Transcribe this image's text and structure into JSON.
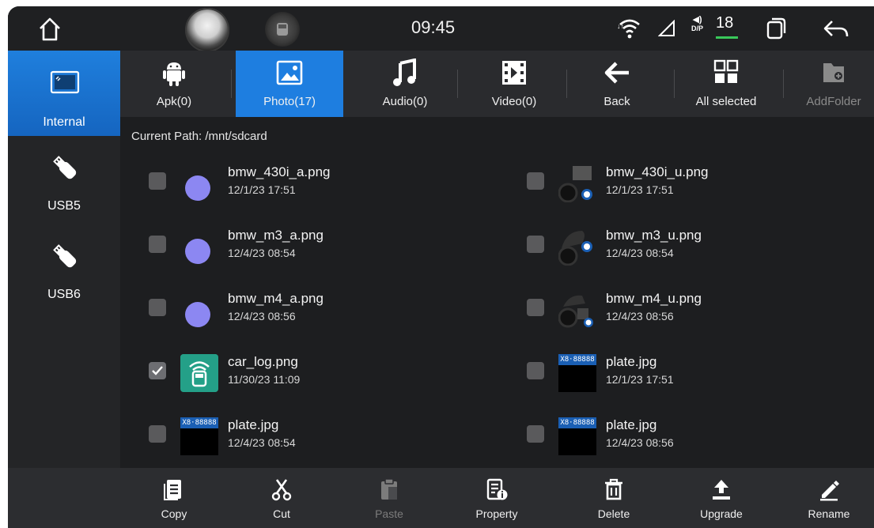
{
  "status_bar": {
    "time": "09:45",
    "volume_label": "D/P",
    "volume_value": "18",
    "accent_green": "#39c85a"
  },
  "sidebar": {
    "items": [
      {
        "label": "Internal",
        "icon": "storage-icon",
        "active": true
      },
      {
        "label": "USB5",
        "icon": "usb-icon",
        "active": false
      },
      {
        "label": "USB6",
        "icon": "usb-icon",
        "active": false
      }
    ]
  },
  "toolbar": {
    "items": [
      {
        "label": "Apk(0)",
        "icon": "android-icon"
      },
      {
        "label": "Photo(17)",
        "icon": "image-icon",
        "active": true
      },
      {
        "label": "Audio(0)",
        "icon": "music-note-icon"
      },
      {
        "label": "Video(0)",
        "icon": "film-icon"
      },
      {
        "label": "Back",
        "icon": "arrow-left-icon"
      },
      {
        "label": "All selected",
        "icon": "grid-icon"
      },
      {
        "label": "AddFolder",
        "icon": "add-folder-icon",
        "disabled": true
      }
    ]
  },
  "path": "Current Path: /mnt/sdcard",
  "files": [
    {
      "name": "bmw_430i_a.png",
      "date": "12/1/23 17:51",
      "checked": false,
      "thumb": "dot"
    },
    {
      "name": "bmw_430i_u.png",
      "date": "12/1/23 17:51",
      "checked": false,
      "thumb": "bmw"
    },
    {
      "name": "bmw_m3_a.png",
      "date": "12/4/23 08:54",
      "checked": false,
      "thumb": "dot"
    },
    {
      "name": "bmw_m3_u.png",
      "date": "12/4/23 08:54",
      "checked": false,
      "thumb": "bmw"
    },
    {
      "name": "bmw_m4_a.png",
      "date": "12/4/23 08:56",
      "checked": false,
      "thumb": "dot"
    },
    {
      "name": "bmw_m4_u.png",
      "date": "12/4/23 08:56",
      "checked": false,
      "thumb": "bmw"
    },
    {
      "name": "car_log.png",
      "date": "11/30/23 11:09",
      "checked": true,
      "thumb": "carlog"
    },
    {
      "name": "plate.jpg",
      "date": "12/1/23 17:51",
      "checked": false,
      "thumb": "plate"
    },
    {
      "name": "plate.jpg",
      "date": "12/4/23 08:54",
      "checked": false,
      "thumb": "plate"
    },
    {
      "name": "plate.jpg",
      "date": "12/4/23 08:56",
      "checked": false,
      "thumb": "plate"
    }
  ],
  "plate_text": "X8·88888",
  "bottom_toolbar": {
    "items": [
      {
        "label": "Copy",
        "icon": "copy-icon"
      },
      {
        "label": "Cut",
        "icon": "scissors-icon"
      },
      {
        "label": "Paste",
        "icon": "paste-icon",
        "disabled": true
      },
      {
        "label": "Property",
        "icon": "property-icon"
      },
      {
        "label": "Delete",
        "icon": "trash-icon"
      },
      {
        "label": "Upgrade",
        "icon": "upload-icon"
      },
      {
        "label": "Rename",
        "icon": "pencil-icon"
      }
    ]
  },
  "colors": {
    "accent_blue": "#1e7ee0",
    "dot_purple": "#8c87f2"
  }
}
